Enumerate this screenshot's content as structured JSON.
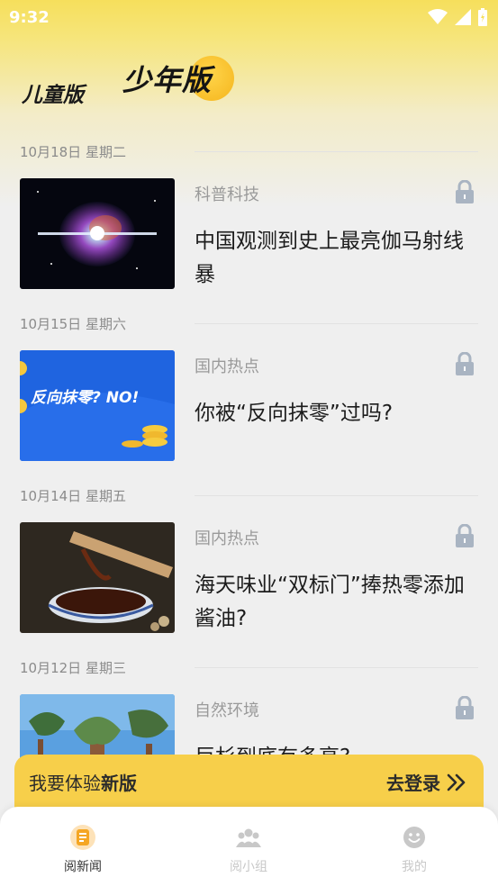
{
  "status_bar": {
    "time": "9:32"
  },
  "mode_tabs": {
    "kid": "儿童版",
    "teen": "少年版"
  },
  "feed": [
    {
      "date": "10月18日 星期二",
      "category": "科普科技",
      "headline": "中国观测到史上最亮伽马射线暴"
    },
    {
      "date": "10月15日 星期六",
      "category": "国内热点",
      "headline": "你被“反向抹零”过吗?",
      "thumb_text": "反向抹零? NO!"
    },
    {
      "date": "10月14日 星期五",
      "category": "国内热点",
      "headline": "海天味业“双标门”捧热零添加酱油?"
    },
    {
      "date": "10月12日 星期三",
      "category": "自然环境",
      "headline": "巨杉到底有多高?"
    }
  ],
  "banner": {
    "text_prefix": "我要体验",
    "text_bold": "新版",
    "action": "去登录"
  },
  "bottom_nav": [
    {
      "label": "阅新闻",
      "icon": "news-icon",
      "active": true
    },
    {
      "label": "阅小组",
      "icon": "group-icon",
      "active": false
    },
    {
      "label": "我的",
      "icon": "smile-icon",
      "active": false
    }
  ],
  "colors": {
    "accent": "#f7cf4a",
    "active_icon": "#f5a623"
  }
}
